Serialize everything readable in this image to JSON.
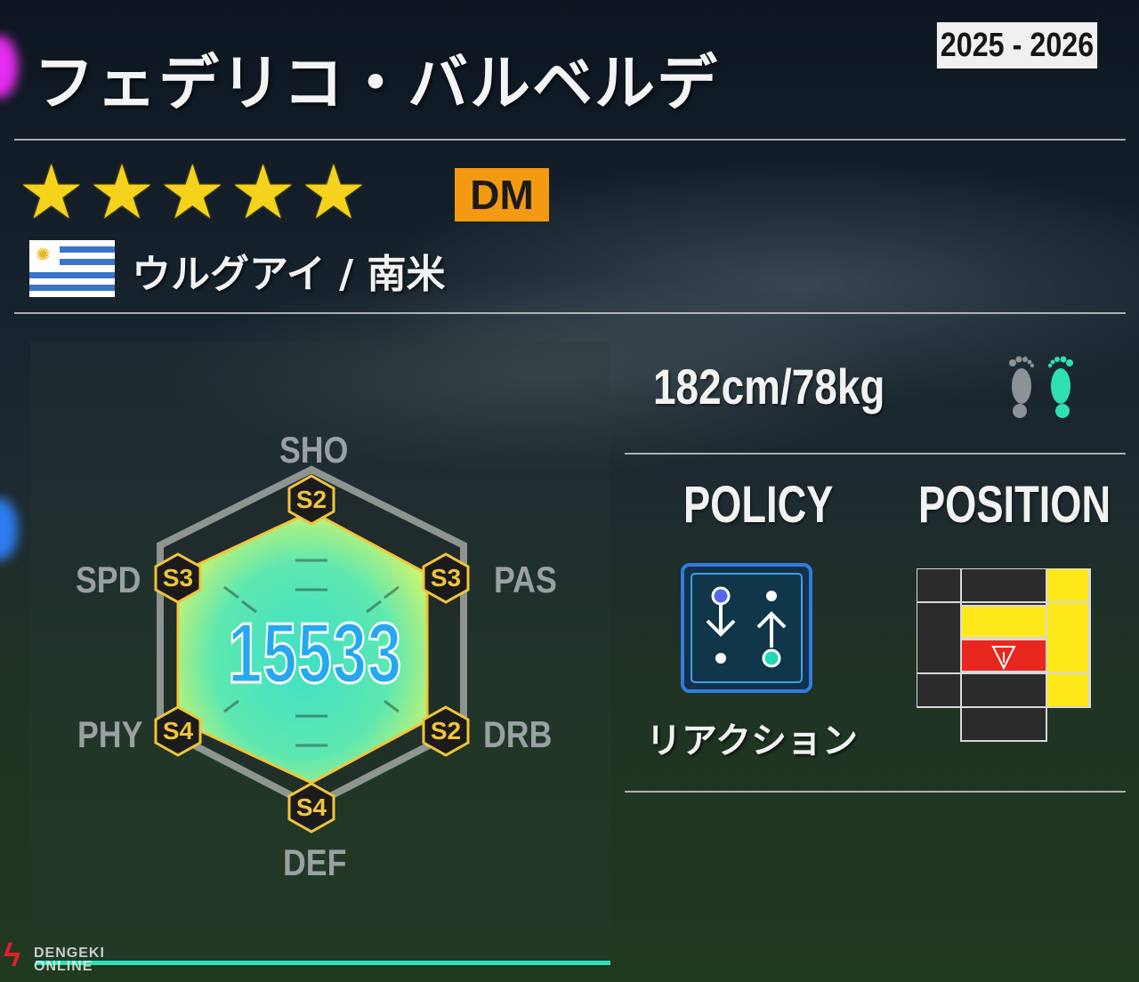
{
  "player": {
    "name": "フェデリコ・バルベルデ",
    "season": "2025 - 2026",
    "stars": 5,
    "position": "DM",
    "nationality": "ウルグアイ / 南米",
    "body": "182cm/78kg",
    "preferred_foot": "right"
  },
  "radar": {
    "power": "15533",
    "stats": [
      {
        "label": "SHO",
        "grade": "S2"
      },
      {
        "label": "PAS",
        "grade": "S3"
      },
      {
        "label": "DRB",
        "grade": "S2"
      },
      {
        "label": "DEF",
        "grade": "S4"
      },
      {
        "label": "PHY",
        "grade": "S4"
      },
      {
        "label": "SPD",
        "grade": "S3"
      }
    ]
  },
  "policy": {
    "heading": "POLICY",
    "label": "リアクション",
    "icon": "reaction-arrows-icon"
  },
  "position_map": {
    "heading": "POSITION",
    "primary_zone": "defensive-midfield"
  },
  "colors": {
    "star": "#f5d21b",
    "position_badge": "#f39a12",
    "radar_fill": "#5ee8b0",
    "grade_gold": "#f0c53b",
    "power_number": "#25a8ef",
    "pos_primary": "#e8271e",
    "pos_secondary": "#ffe81a",
    "accent_bar": "#2ee0b8"
  },
  "watermark": {
    "line1": "DENGEKI",
    "line2": "ONLINE"
  }
}
